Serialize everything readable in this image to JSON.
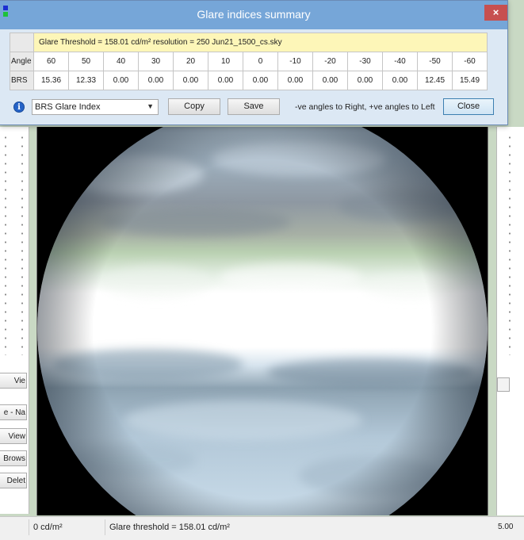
{
  "dialog": {
    "title": "Glare indices summary",
    "info_line": "Glare Threshold = 158.01 cd/m²    resolution = 250    Jun21_1500_cs.sky",
    "row_labels": {
      "angle": "Angle",
      "brs": "BRS"
    },
    "angles": [
      "60",
      "50",
      "40",
      "30",
      "20",
      "10",
      "0",
      "-10",
      "-20",
      "-30",
      "-40",
      "-50",
      "-60"
    ],
    "brs_values": [
      "15.36",
      "12.33",
      "0.00",
      "0.00",
      "0.00",
      "0.00",
      "0.00",
      "0.00",
      "0.00",
      "0.00",
      "0.00",
      "12.45",
      "15.49"
    ],
    "index_select": "BRS Glare Index",
    "copy_label": "Copy",
    "save_label": "Save",
    "hint": "-ve angles to Right, +ve angles to Left",
    "close_label": "Close",
    "close_glyph": "×",
    "info_glyph": "i"
  },
  "left_panel": {
    "buttons": [
      "Vie",
      "e - Na",
      "View",
      "Brows",
      "Delet"
    ]
  },
  "status": {
    "min_luminance": "0 cd/m²",
    "threshold": "Glare threshold =  158.01 cd/m²",
    "right_value": "5.00"
  },
  "colors": {
    "title_bar": "#76a6d8",
    "table_info_row": "#fdf6b8",
    "close_button": "#c75050",
    "sky_white": "#ffffff",
    "sky_grey": "#8c97a3",
    "ground_blue": "#b9cfe0"
  }
}
